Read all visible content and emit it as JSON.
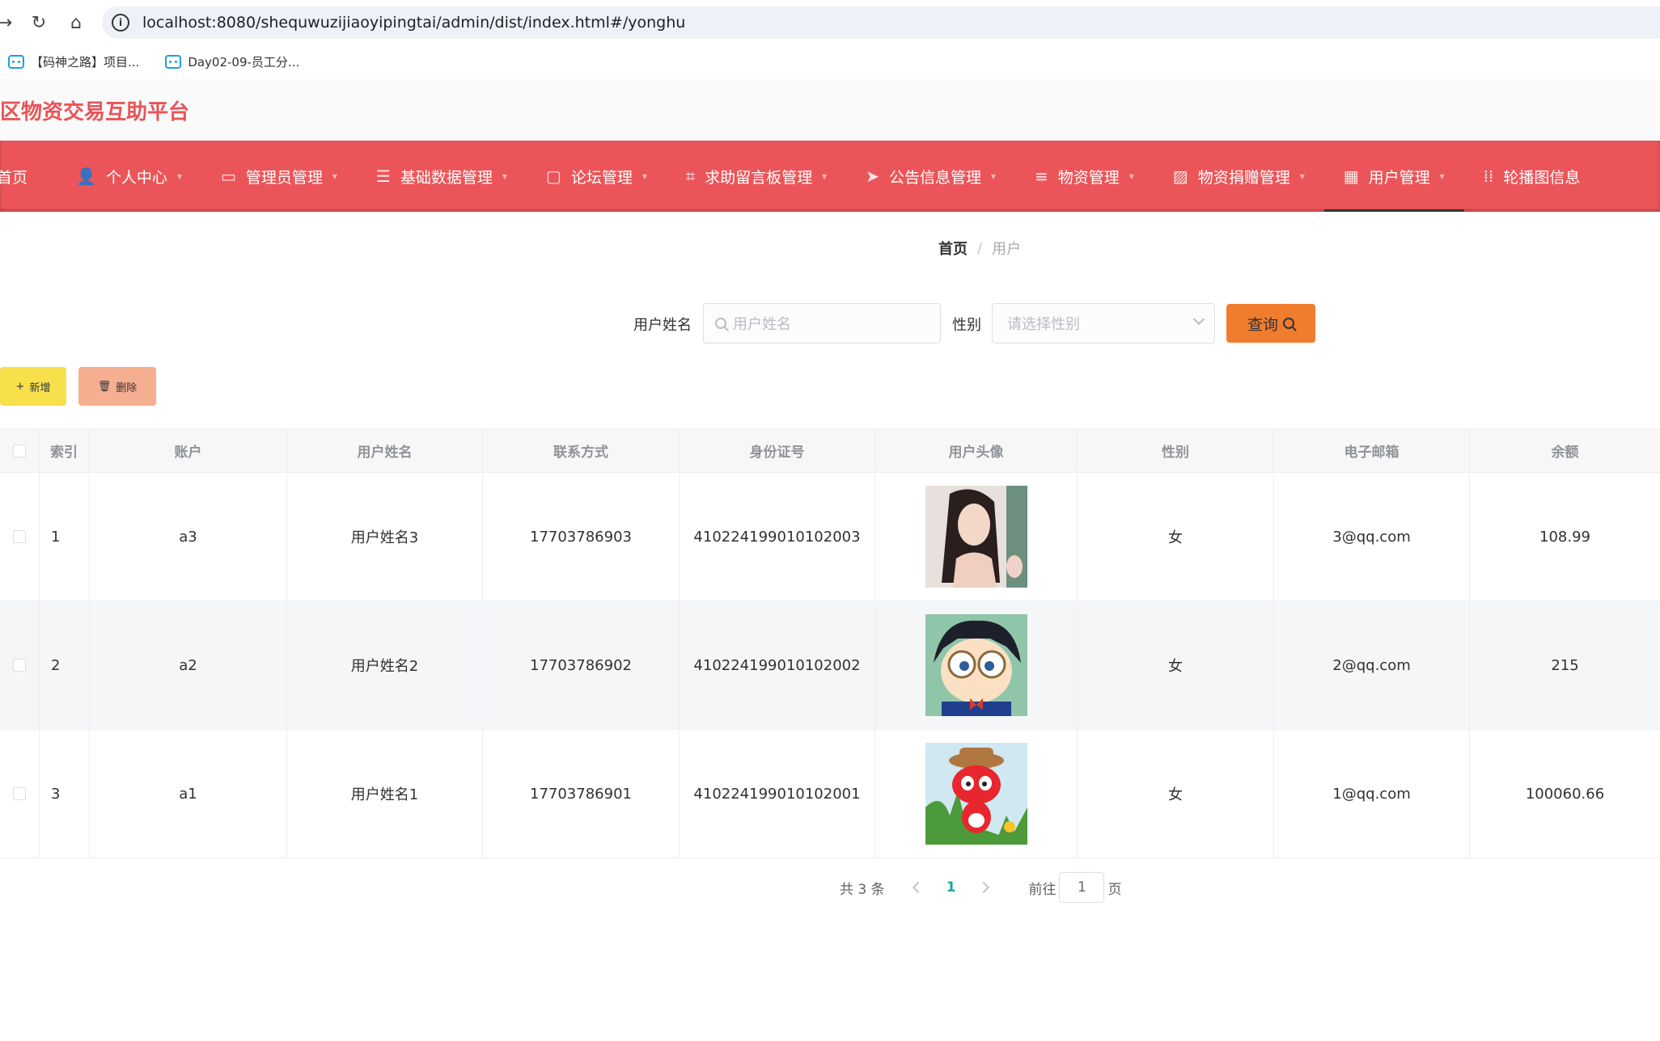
{
  "browser": {
    "url": "localhost:8080/shequwuzijiaoyipingtai/admin/dist/index.html#/yonghu",
    "bookmarks": [
      "【码神之路】项目...",
      "Day02-09-员工分..."
    ]
  },
  "app": {
    "title": "区物资交易互助平台"
  },
  "menu": [
    {
      "label": "首页",
      "icon": "home-icon"
    },
    {
      "label": "个人中心",
      "icon": "user-icon"
    },
    {
      "label": "管理员管理",
      "icon": "monitor-icon"
    },
    {
      "label": "基础数据管理",
      "icon": "sliders-icon"
    },
    {
      "label": "论坛管理",
      "icon": "chat-icon"
    },
    {
      "label": "求助留言板管理",
      "icon": "crop-icon"
    },
    {
      "label": "公告信息管理",
      "icon": "send-icon"
    },
    {
      "label": "物资管理",
      "icon": "list-icon"
    },
    {
      "label": "物资捐赠管理",
      "icon": "chart-icon"
    },
    {
      "label": "用户管理",
      "icon": "grid-icon"
    },
    {
      "label": "轮播图信息",
      "icon": "apps-icon"
    }
  ],
  "breadcrumb": {
    "home": "首页",
    "sep": "/",
    "current": "用户"
  },
  "search": {
    "name_label": "用户姓名",
    "name_placeholder": "用户姓名",
    "gender_label": "性别",
    "gender_placeholder": "请选择性别",
    "query_button": "查询"
  },
  "actions": {
    "add": "新增",
    "delete": "删除"
  },
  "table": {
    "headers": [
      "索引",
      "账户",
      "用户姓名",
      "联系方式",
      "身份证号",
      "用户头像",
      "性别",
      "电子邮箱",
      "余额"
    ],
    "rows": [
      {
        "index": "1",
        "account": "a3",
        "name": "用户姓名3",
        "phone": "17703786903",
        "id_card": "410224199010102003",
        "avatar": "woman-portrait",
        "gender": "女",
        "email": "3@qq.com",
        "balance": "108.99"
      },
      {
        "index": "2",
        "account": "a2",
        "name": "用户姓名2",
        "phone": "17703786902",
        "id_card": "410224199010102002",
        "avatar": "cartoon-boy-glasses",
        "gender": "女",
        "email": "2@qq.com",
        "balance": "215"
      },
      {
        "index": "3",
        "account": "a1",
        "name": "用户姓名1",
        "phone": "17703786901",
        "id_card": "410224199010102001",
        "avatar": "cartoon-red-cat",
        "gender": "女",
        "email": "1@qq.com",
        "balance": "100060.66"
      }
    ]
  },
  "pagination": {
    "total_text": "共 3 条",
    "current_page": "1",
    "goto_label": "前往",
    "goto_value": "1",
    "page_suffix": "页"
  },
  "colors": {
    "primary": "#eb5559",
    "query": "#f07c2e",
    "add": "#f7e04b",
    "delete": "#f6ae91",
    "page_active": "#1aa6a6"
  }
}
